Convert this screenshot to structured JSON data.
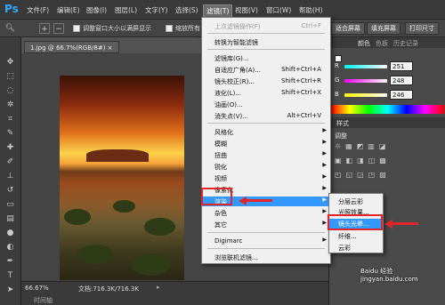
{
  "menubar": {
    "logo": "Ps",
    "items": [
      "文件(F)",
      "编辑(E)",
      "图像(I)",
      "图层(L)",
      "文字(Y)",
      "选择(S)",
      "滤镜(T)",
      "视图(V)",
      "窗口(W)",
      "帮助(H)"
    ]
  },
  "options": {
    "resize": "调整窗口大小以满屏显示",
    "zoom_all": "缩放所有",
    "fit_screen": "适合屏幕",
    "fill_screen": "填充屏幕",
    "print_size": "打印尺寸"
  },
  "doc_tab": "1.jpg @ 66.7%(RGB/8#)",
  "status": {
    "zoom": "66.67%",
    "doc": "文档:716.3K/716.3K",
    "timeline": "时间轴"
  },
  "panel": {
    "tab_color": "颜色",
    "tab_swatches": "色板",
    "tab_history": "历史记录",
    "r_label": "R",
    "g_label": "G",
    "b_label": "B",
    "r": "251",
    "g": "248",
    "b": "246",
    "styles_tab": "样式",
    "adjust_title": "调整"
  },
  "filter_menu": {
    "last": "上次滤镜操作(F)",
    "last_sc": "Ctrl+F",
    "smart": "转换为智能滤镜",
    "gallery": "滤镜库(G)...",
    "adaptive": "自适应广角(A)...",
    "adaptive_sc": "Shift+Ctrl+A",
    "lens": "镜头校正(R)...",
    "lens_sc": "Shift+Ctrl+R",
    "liquify": "液化(L)...",
    "liquify_sc": "Shift+Ctrl+X",
    "oil": "油画(O)...",
    "vanish": "消失点(V)...",
    "vanish_sc": "Alt+Ctrl+V",
    "stylize": "风格化",
    "blur": "模糊",
    "distort": "扭曲",
    "sharpen": "锐化",
    "video": "视频",
    "pixelate": "像素化",
    "render": "渲染",
    "noise": "杂色",
    "other": "其它",
    "digimarc": "Digimarc",
    "browse": "浏览联机滤镜..."
  },
  "render_submenu": {
    "clouds": "分层云彩",
    "lighting": "光照效果...",
    "lens_flare": "镜头光晕...",
    "fibers": "纤维...",
    "clouds2": "云彩"
  },
  "watermark": "Baidu 经验 jingyan.baidu.com",
  "colors": {
    "highlight": "#3399ff",
    "annotation": "#e0262b"
  }
}
